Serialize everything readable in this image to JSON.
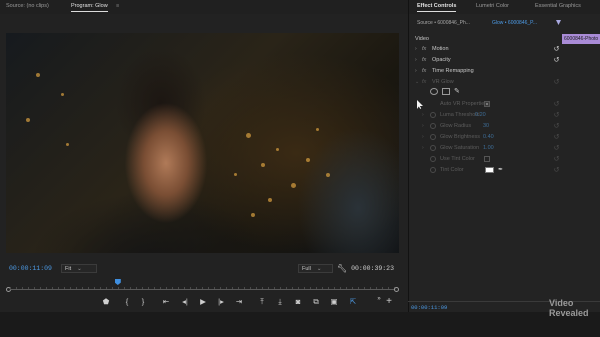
{
  "program_monitor": {
    "source_tab": "Source: (no clips)",
    "program_tab": "Program: Glow",
    "menu_icon": "hamburger-icon",
    "timecode_current": "00:00:11:09",
    "fit_select": "Fit",
    "quality_select": "Full",
    "timecode_duration": "00:00:39:23",
    "playhead_progress": 0.28,
    "transport_icons": [
      "marker-icon",
      "in-point-icon",
      "out-point-icon",
      "go-to-in-icon",
      "step-back-icon",
      "play-icon",
      "step-forward-icon",
      "go-to-out-icon",
      "lift-icon",
      "extract-icon",
      "export-frame-icon",
      "comparison-view-icon",
      "proxy-toggle-icon",
      "more-icon",
      "add-button-icon"
    ]
  },
  "effect_controls": {
    "tabs": [
      "Effect Controls",
      "Lumetri Color",
      "Essential Graphics"
    ],
    "source_label": "Source • 6000846_Ph...",
    "clip_label": "Glow • 6000846_P...",
    "mini_clip_label": "6000846-Photo",
    "section_label": "Video",
    "effects": [
      {
        "name": "Motion",
        "has_reset": true
      },
      {
        "name": "Opacity",
        "has_reset": true
      },
      {
        "name": "Time Remapping",
        "has_reset": false
      },
      {
        "name": "VR Glow",
        "has_reset": true,
        "dimmed": true
      }
    ],
    "vr_glow_params": [
      {
        "name": "Auto VR Properties",
        "control": "checkbox-checked"
      },
      {
        "name": "Luma Threshold",
        "value": "0.20"
      },
      {
        "name": "Glow Radius",
        "value": "30"
      },
      {
        "name": "Glow Brightness",
        "value": "0.40"
      },
      {
        "name": "Glow Saturation",
        "value": "1.00"
      },
      {
        "name": "Use Tint Color",
        "control": "checkbox-empty"
      },
      {
        "name": "Tint Color",
        "control": "color-swatch",
        "color": "#ffffff"
      }
    ],
    "footer_timecode": "00:00:11:09"
  },
  "watermark": {
    "line1": "Video",
    "line2": "Revealed"
  }
}
